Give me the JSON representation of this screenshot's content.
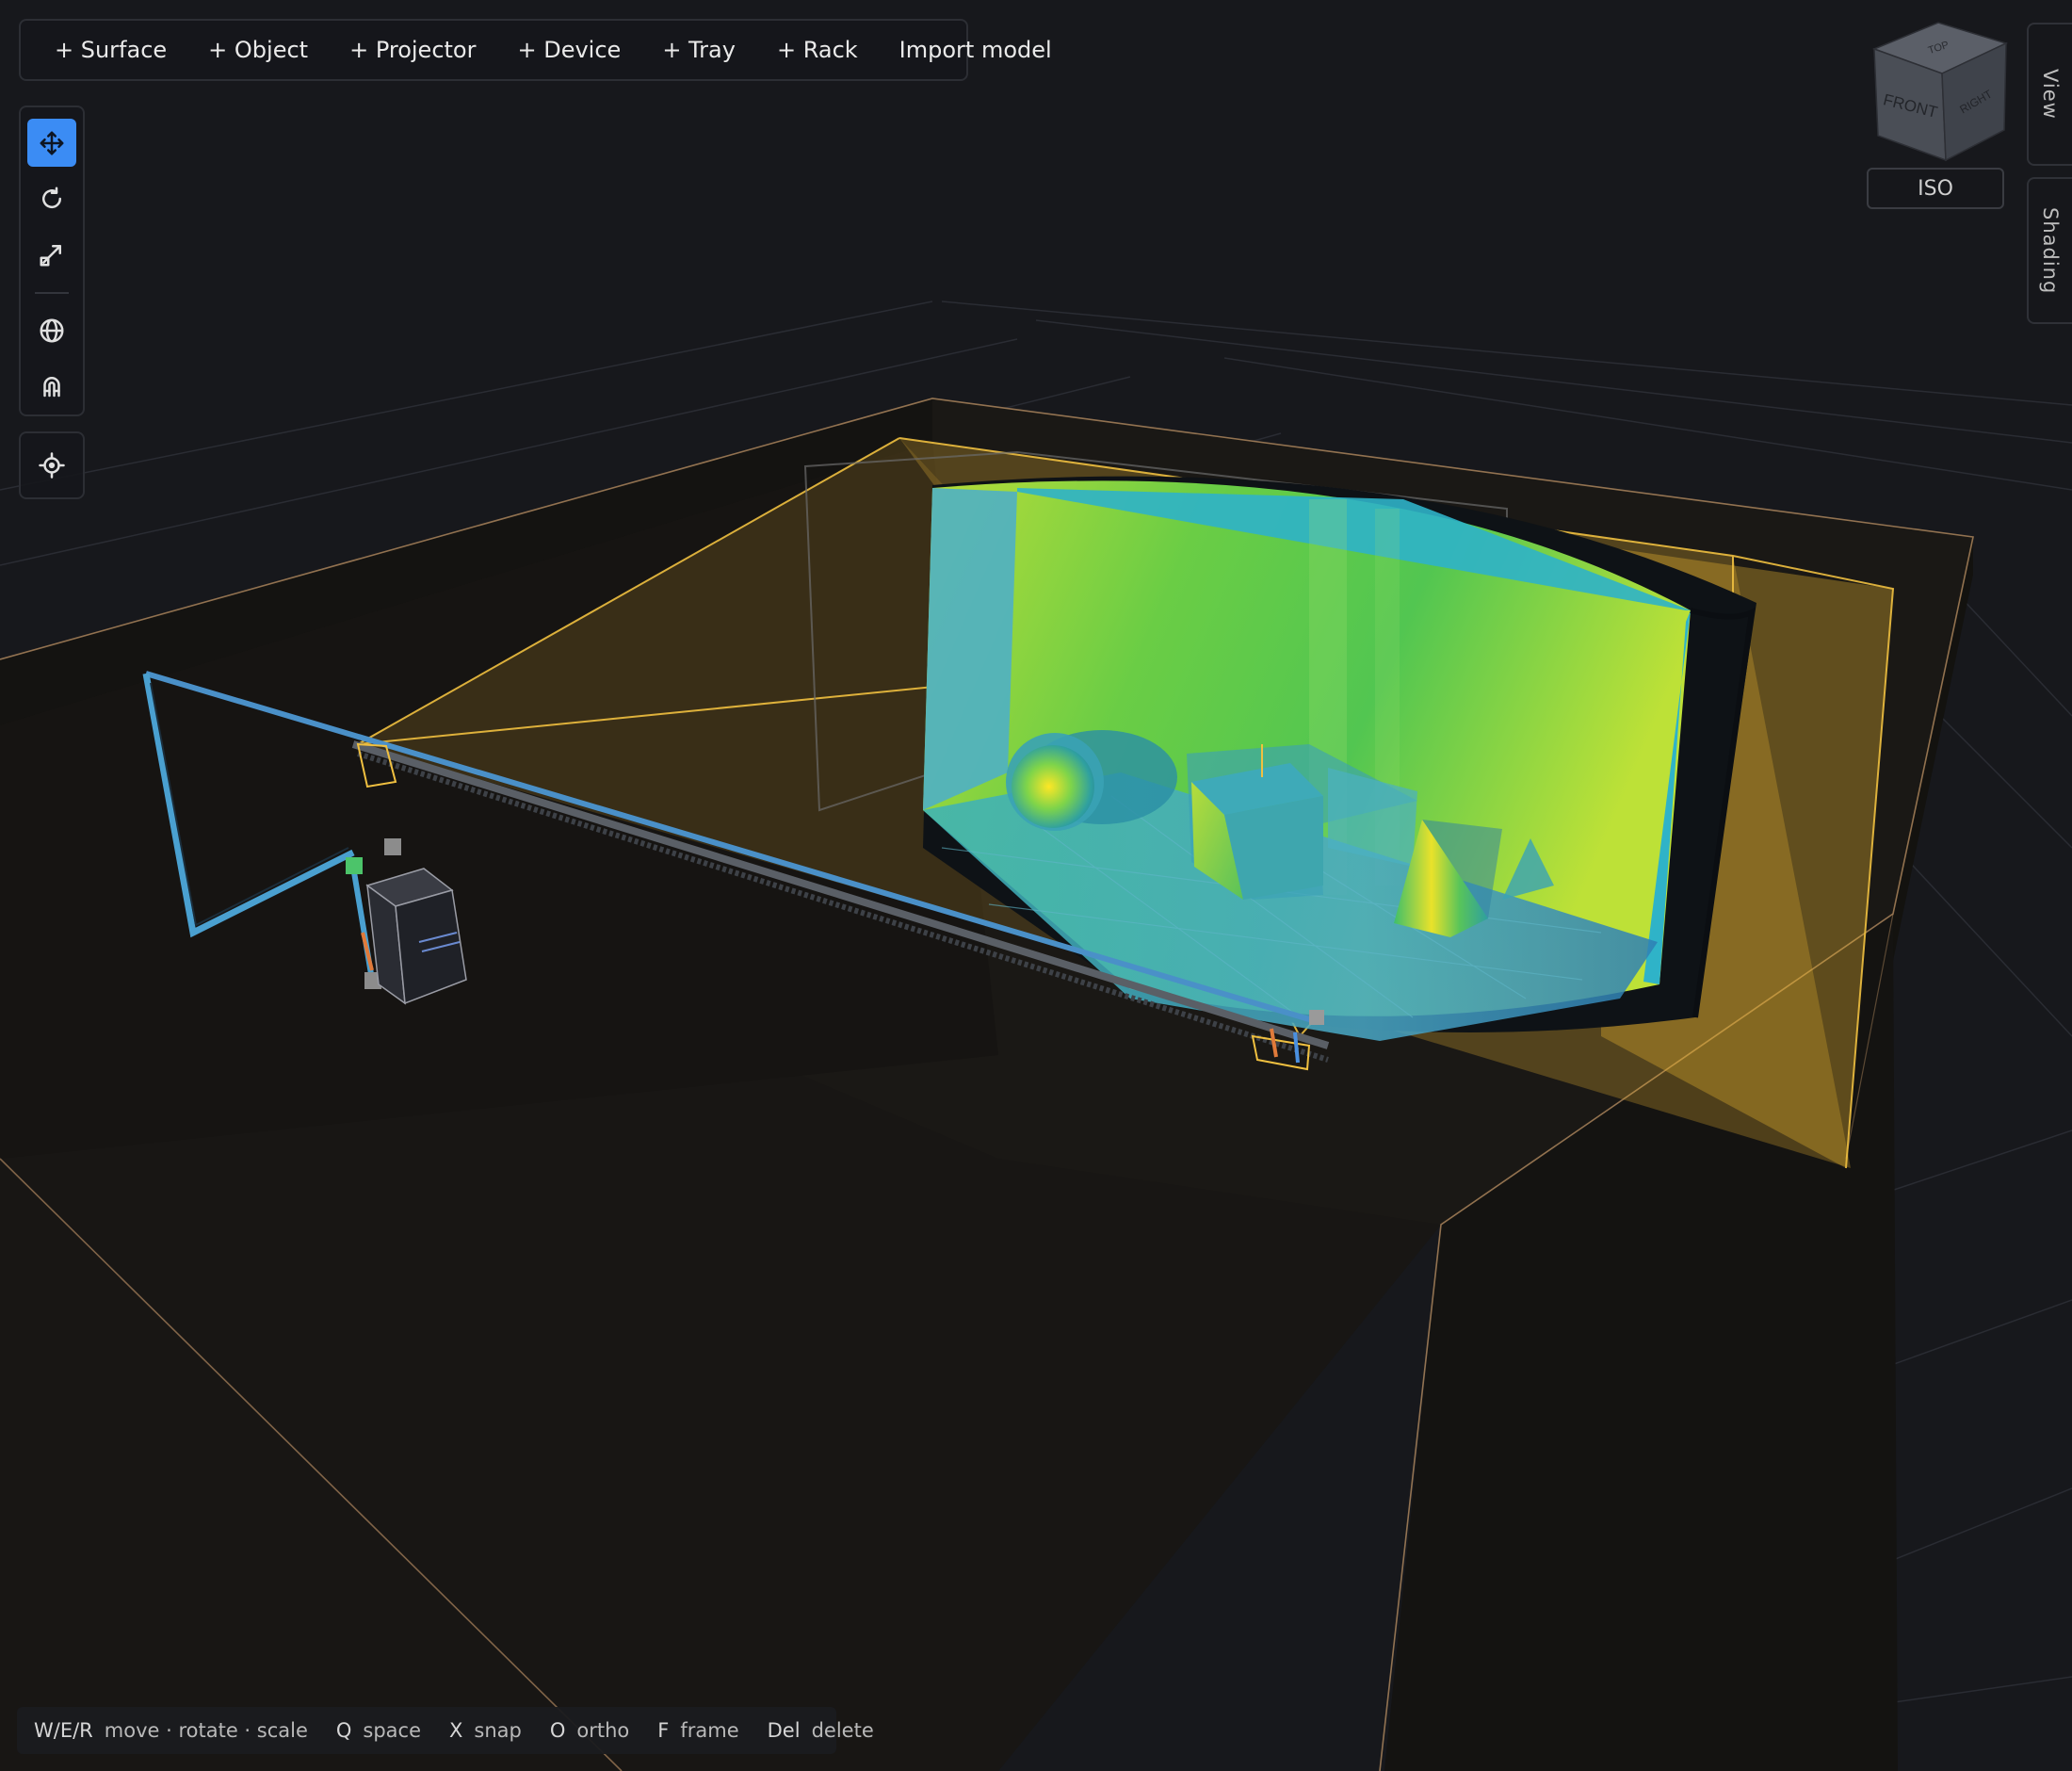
{
  "toolbar": {
    "surface": "+ Surface",
    "object": "+ Object",
    "projector": "+ Projector",
    "device": "+ Device",
    "tray": "+ Tray",
    "rack": "+ Rack",
    "import_model": "Import model"
  },
  "tools": {
    "active": "move",
    "items": [
      "move-icon",
      "rotate-icon",
      "scale-icon",
      "globe-icon",
      "magnet-icon",
      "focus-target-icon"
    ]
  },
  "viewcube": {
    "top": "TOP",
    "front": "FRONT",
    "right": "RIGHT",
    "mode_label": "ISO"
  },
  "side_tabs": {
    "view": "View",
    "shading": "Shading"
  },
  "hints": [
    {
      "key": "W/E/R",
      "action": "move · rotate · scale"
    },
    {
      "key": "Q",
      "action": "space"
    },
    {
      "key": "X",
      "action": "snap"
    },
    {
      "key": "O",
      "action": "ortho"
    },
    {
      "key": "F",
      "action": "frame"
    },
    {
      "key": "Del",
      "action": "delete"
    }
  ],
  "colors": {
    "background": "#17181c",
    "accent": "#3b8cf4",
    "frustum": "#f0c040",
    "screen_edge": "#2fb3c8",
    "room_outline": "#c89a6a"
  }
}
